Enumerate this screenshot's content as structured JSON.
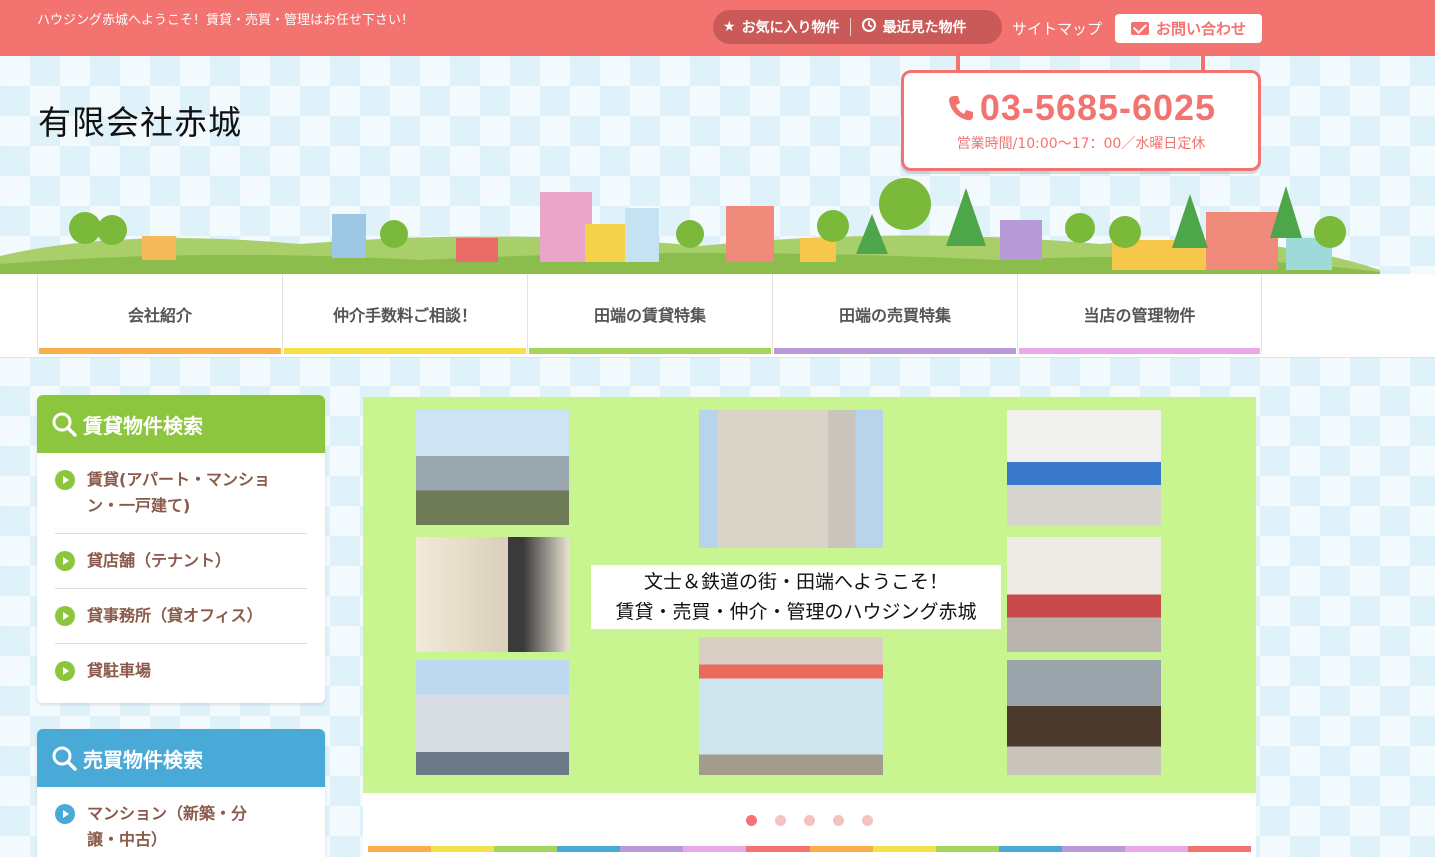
{
  "topbar": {
    "tagline": "ハウジング赤城へようこそ！賃貸・売買・管理はお任せ下さい！",
    "favorites": "お気に入り物件",
    "recent": "最近見た物件",
    "sitemap": "サイトマップ",
    "contact": "お問い合わせ"
  },
  "header": {
    "company": "有限会社赤城",
    "phone": "03-5685-6025",
    "hours": "営業時間/10:00〜17：00／水曜日定休"
  },
  "nav": [
    {
      "label": "会社紹介",
      "color": "#f7b04b"
    },
    {
      "label": "仲介手数料ご相談！",
      "color": "#f5e04a"
    },
    {
      "label": "田端の賃貸特集",
      "color": "#a3d65a"
    },
    {
      "label": "田端の売買特集",
      "color": "#b89ad8"
    },
    {
      "label": "当店の管理物件",
      "color": "#e9a8e8"
    }
  ],
  "rental_search": {
    "title": "賃貸物件検索",
    "color": "#8cc63e",
    "items": [
      {
        "line1": "賃貸(アパート・マンショ",
        "line2": "ン・一戸建て)"
      },
      {
        "line1": "貸店舗（テナント）",
        "line2": ""
      },
      {
        "line1": "貸事務所（貸オフィス）",
        "line2": ""
      },
      {
        "line1": "貸駐車場",
        "line2": ""
      }
    ]
  },
  "sale_search": {
    "title": "売買物件検索",
    "color": "#4aaad7",
    "items": [
      {
        "line1": "マンション（新築・分",
        "line2": "譲・中古）"
      }
    ]
  },
  "slider": {
    "caption_line1": "文士＆鉄道の街・田端へようこそ！",
    "caption_line2": "賃貸・売買・仲介・管理のハウジング赤城",
    "dot_count": 5,
    "active_dot": 1
  },
  "colors": {
    "accent": "#f2736f",
    "slide_bg": "#c8f58f"
  }
}
